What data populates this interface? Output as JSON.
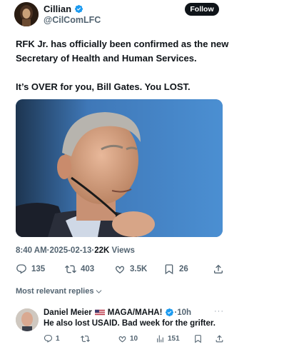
{
  "post": {
    "author_name": "Cillian",
    "author_handle": "@CilComLFC",
    "follow_label": "Follow",
    "text_lines": [
      "RFK Jr. has officially been confirmed as the new Secretary of Health and Human Services.",
      "It’s OVER for you, Bill Gates. You LOST."
    ],
    "time": "8:40 AM",
    "separator": "·",
    "date": "2025-02-13",
    "views_count": "22K",
    "views_label": "Views",
    "stats": {
      "replies": "135",
      "reposts": "403",
      "likes": "3.5K",
      "bookmarks": "26"
    }
  },
  "replies_sort": {
    "label": "Most relevant replies"
  },
  "reply": {
    "author_name": "Daniel Meier",
    "tag": "MAGA/MAHA!",
    "time": "·10h",
    "text": "He also lost USAID. Bad week for the grifter.",
    "more": "···",
    "stats": {
      "replies": "1",
      "likes": "10",
      "views": "151"
    }
  },
  "colors": {
    "text_primary": "#0f1419",
    "text_secondary": "#536471",
    "verified_blue": "#1d9bf0",
    "follow_bg": "#0f1419"
  },
  "icons": [
    "verified-badge-icon",
    "reply-icon",
    "repost-icon",
    "like-icon",
    "bookmark-icon",
    "share-icon",
    "chevron-down-icon",
    "views-icon",
    "more-icon",
    "us-flag-icon"
  ]
}
